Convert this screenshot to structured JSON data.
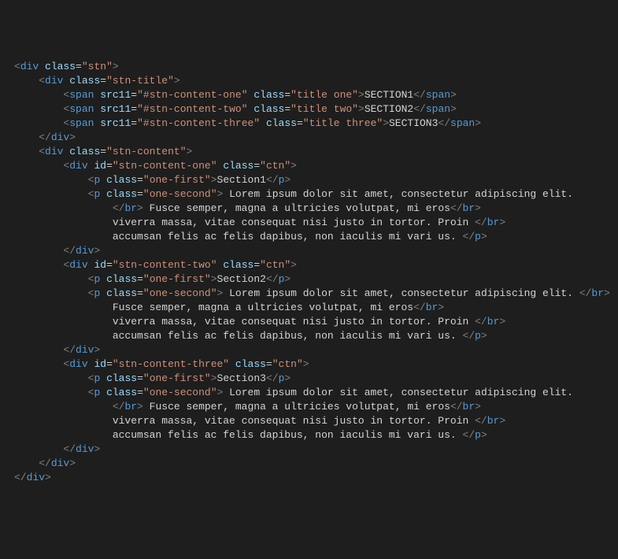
{
  "tokens": {
    "tag_div": "div",
    "tag_span": "span",
    "tag_p": "p",
    "tag_br": "br",
    "attr_class": "class",
    "attr_id": "id",
    "attr_src11": "src11"
  },
  "indent": "    ",
  "root": {
    "class": "stn"
  },
  "title_wrap": {
    "class": "stn-title"
  },
  "content_wrap": {
    "class": "stn-content"
  },
  "titles": [
    {
      "src": "#stn-content-one",
      "class": "title one",
      "text": "SECTION1"
    },
    {
      "src": "#stn-content-two",
      "class": "title two",
      "text": "SECTION2"
    },
    {
      "src": "#stn-content-three",
      "class": "title three",
      "text": "SECTION3"
    }
  ],
  "sections": [
    {
      "id": "stn-content-one",
      "class": "ctn",
      "heading_class": "one-first",
      "heading": "Section1",
      "body_class": "one-second",
      "body_layout": "A",
      "lines": [
        "Lorem ipsum dolor sit amet, consectetur adipiscing elit.",
        "Fusce semper, magna a ultricies volutpat, mi eros",
        "viverra massa, vitae consequat nisi justo in tortor. Proin",
        "accumsan felis ac felis dapibus, non iaculis mi vari us."
      ]
    },
    {
      "id": "stn-content-two",
      "class": "ctn",
      "heading_class": "one-first",
      "heading": "Section2",
      "body_class": "one-second",
      "body_layout": "B",
      "lines": [
        "Lorem ipsum dolor sit amet, consectetur adipiscing elit.",
        "Fusce semper, magna a ultricies volutpat, mi eros",
        "viverra massa, vitae consequat nisi justo in tortor. Proin",
        "accumsan felis ac felis dapibus, non iaculis mi vari us."
      ]
    },
    {
      "id": "stn-content-three",
      "class": "ctn",
      "heading_class": "one-first",
      "heading": "Section3",
      "body_class": "one-second",
      "body_layout": "A",
      "lines": [
        "Lorem ipsum dolor sit amet, consectetur adipiscing elit.",
        "Fusce semper, magna a ultricies volutpat, mi eros",
        "viverra massa, vitae consequat nisi justo in tortor. Proin",
        "accumsan felis ac felis dapibus, non iaculis mi vari us."
      ]
    }
  ]
}
